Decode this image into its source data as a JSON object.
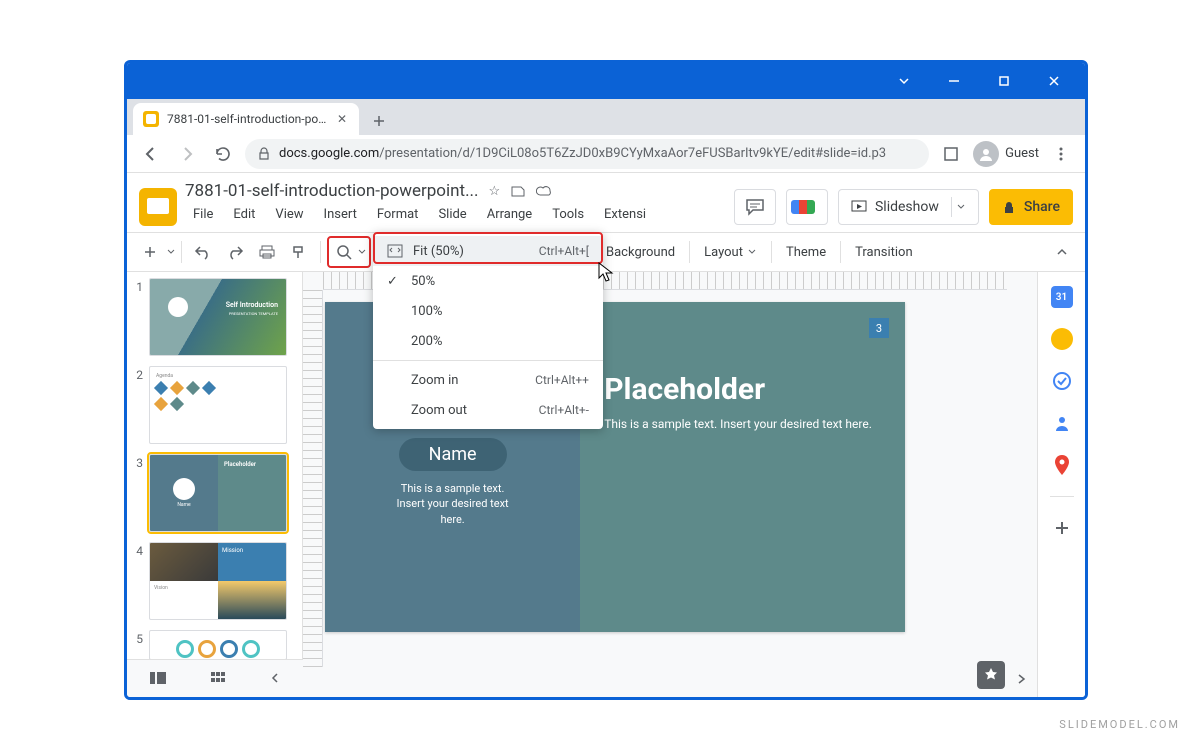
{
  "browser": {
    "tab_title": "7881-01-self-introduction-powe",
    "url_host": "docs.google.com",
    "url_path": "/presentation/d/1D9CiL08o5T6ZzJD0xB9CYyMxaAor7eFUSBarItv9kYE/edit#slide=id.p3",
    "guest_label": "Guest"
  },
  "app": {
    "doc_title": "7881-01-self-introduction-powerpoint...",
    "menus": [
      "File",
      "Edit",
      "View",
      "Insert",
      "Format",
      "Slide",
      "Arrange",
      "Tools",
      "Extensi"
    ],
    "slideshow": "Slideshow",
    "share": "Share"
  },
  "toolbar": {
    "background": "Background",
    "layout": "Layout",
    "theme": "Theme",
    "transition": "Transition"
  },
  "zoom_menu": {
    "fit_label": "Fit (50%)",
    "fit_shortcut": "Ctrl+Alt+[",
    "p50": "50%",
    "p100": "100%",
    "p200": "200%",
    "zoom_in": "Zoom in",
    "zoom_in_shortcut": "Ctrl+Alt++",
    "zoom_out": "Zoom out",
    "zoom_out_shortcut": "Ctrl+Alt+-"
  },
  "slides_panel": {
    "numbers": [
      "1",
      "2",
      "3",
      "4",
      "5"
    ],
    "s1_title": "Self Introduction",
    "s1_sub": "PRESENTATION TEMPLATE",
    "s2_label": "Agenda",
    "s3_title": "Placeholder",
    "s3_name": "Name",
    "s4_mission": "Mission",
    "s4_vision": "Vision"
  },
  "slide": {
    "name": "Name",
    "sample1": "This is a sample text.",
    "sample2": "Insert your desired text",
    "sample3": "here.",
    "title": "Placeholder",
    "subtitle": "This is a sample text. Insert your desired text here.",
    "page": "3"
  },
  "watermark": "SLIDEMODEL.COM"
}
